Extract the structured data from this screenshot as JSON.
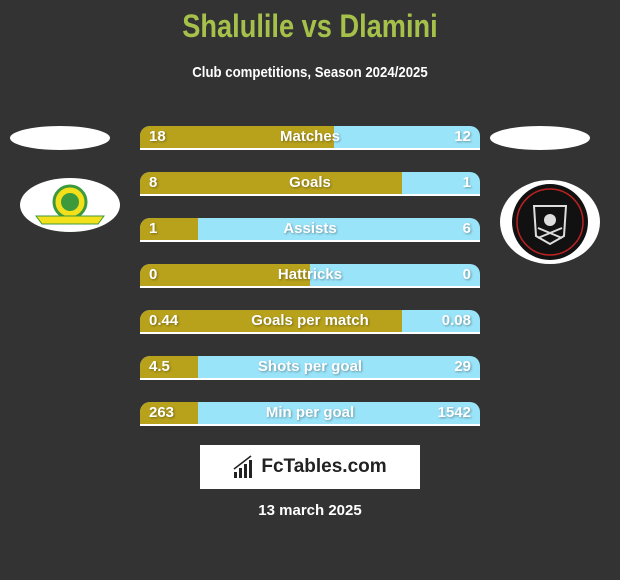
{
  "header": {
    "title": "Shalulile vs Dlamini",
    "subtitle": "Club competitions, Season 2024/2025"
  },
  "colors": {
    "left": "#b8a21c",
    "right": "#9ae4fa",
    "title": "#a6c14a",
    "background": "#333333"
  },
  "stats": [
    {
      "label": "Matches",
      "left": "18",
      "right": "12",
      "left_share": 0.57
    },
    {
      "label": "Goals",
      "left": "8",
      "right": "1",
      "left_share": 0.77
    },
    {
      "label": "Assists",
      "left": "1",
      "right": "6",
      "left_share": 0.17
    },
    {
      "label": "Hattricks",
      "left": "0",
      "right": "0",
      "left_share": 0.5
    },
    {
      "label": "Goals per match",
      "left": "0.44",
      "right": "0.08",
      "left_share": 0.77
    },
    {
      "label": "Shots per goal",
      "left": "4.5",
      "right": "29",
      "left_share": 0.17
    },
    {
      "label": "Min per goal",
      "left": "263",
      "right": "1542",
      "left_share": 0.17
    }
  ],
  "footer": {
    "brand": "FcTables.com",
    "date": "13 march 2025"
  },
  "logos": {
    "left": "Mamelodi Sundowns crest",
    "right": "Orlando Pirates crest 1937"
  }
}
